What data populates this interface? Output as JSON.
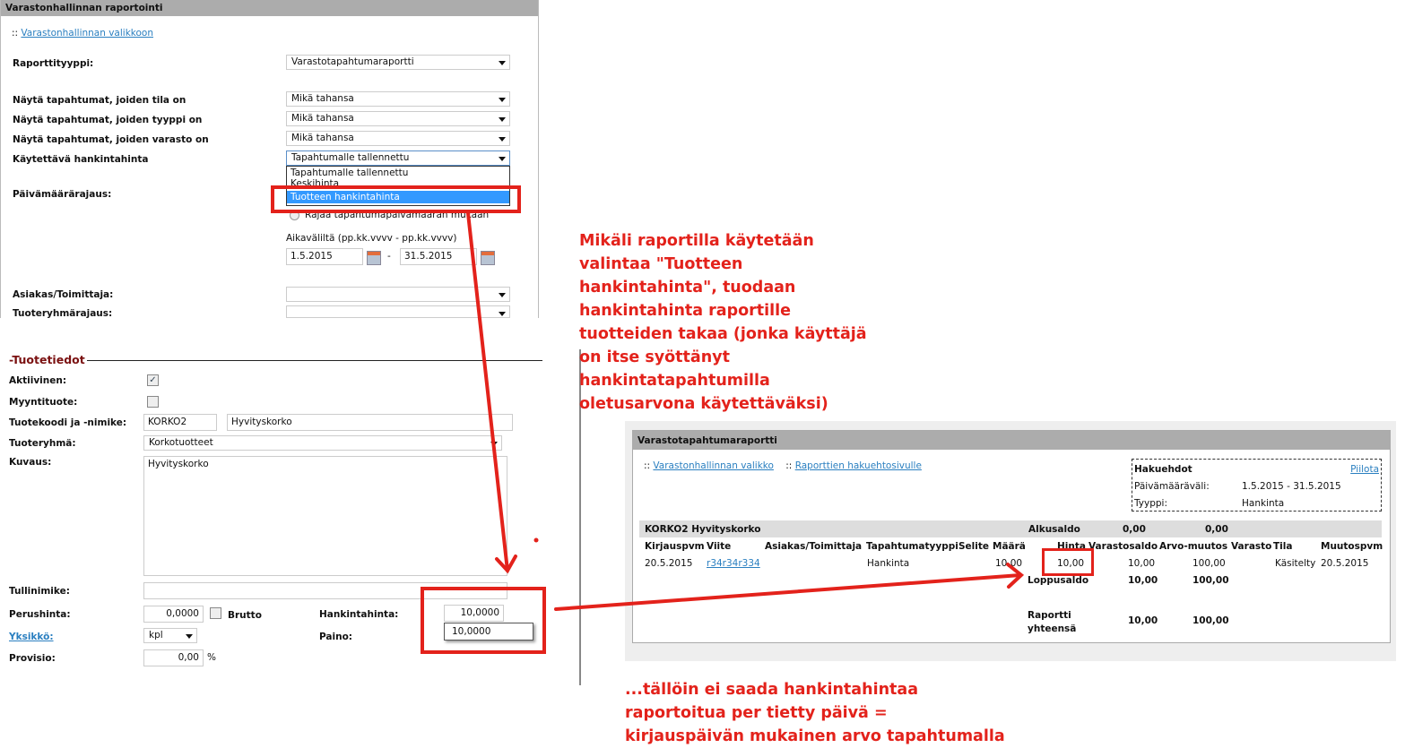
{
  "report_form": {
    "title": "Varastonhallinnan raportointi",
    "back_link": "Varastonhallinnan valikkoon",
    "fields": [
      {
        "label": "Raporttityyppi:",
        "value": "Varastotapahtumaraportti"
      },
      {
        "label": "Näytä tapahtumat, joiden tila on",
        "value": "Mikä tahansa"
      },
      {
        "label": "Näytä tapahtumat, joiden tyyppi on",
        "value": "Mikä tahansa"
      },
      {
        "label": "Näytä tapahtumat, joiden varasto on",
        "value": "Mikä tahansa"
      },
      {
        "label": "Käytettävä hankintahinta",
        "value": "Tapahtumalle tallennettu"
      }
    ],
    "dropdown_options": [
      "Tapahtumalle tallennettu",
      "Keskihinta",
      "Tuotteen hankintahinta"
    ],
    "date_label": "Päivämäärärajaus:",
    "date_radio": "Rajaa tapahtumapäivämäärän mukaan",
    "range_label": "Aikaväliltä (pp.kk.vvvv - pp.kk.vvvv)",
    "date_from": "1.5.2015",
    "date_sep": "-",
    "date_to": "31.5.2015",
    "customer_label": "Asiakas/Toimittaja:",
    "group_label": "Tuoteryhmärajaus:"
  },
  "product": {
    "legend": "Tuotetiedot",
    "active_label": "Aktiivinen:",
    "sales_label": "Myyntituote:",
    "code_label": "Tuotekoodi ja -nimike:",
    "code": "KORKO2",
    "name": "Hyvityskorko",
    "group_label": "Tuoteryhmä:",
    "group": "Korkotuotteet",
    "desc_label": "Kuvaus:",
    "desc": "Hyvityskorko",
    "customs_label": "Tullinimike:",
    "base_price_label": "Perushinta:",
    "base_price": "0,0000",
    "gross_label": "Brutto",
    "purchase_label": "Hankintahinta:",
    "purchase_price": "10,0000",
    "autocomplete": "10,0000",
    "unit_label": "Yksikkö:",
    "unit": "kpl",
    "weight_label": "Paino:",
    "commission_label": "Provisio:",
    "commission": "0,00",
    "pct": "%"
  },
  "report": {
    "title": "Varastotapahtumaraportti",
    "link1": "Varastonhallinnan valikko",
    "link2": "Raporttien hakuehtosivulle",
    "criteria": {
      "title": "Hakuehdot",
      "hide": "Piilota",
      "date_label": "Päivämääräväli:",
      "date_value": "1.5.2015 - 31.5.2015",
      "type_label": "Tyyppi:",
      "type_value": "Hankinta"
    },
    "product": "KORKO2 Hyvityskorko",
    "start_label": "Alkusaldo",
    "start_qty": "0,00",
    "start_value": "0,00",
    "columns": [
      "Kirjauspvm",
      "Viite",
      "Asiakas/Toimittaja",
      "Tapahtumatyyppi",
      "Selite",
      "Määrä",
      "Hinta",
      "Varastosaldo",
      "Arvo-muutos",
      "Varasto",
      "Tila",
      "Muutospvm"
    ],
    "row": {
      "date": "20.5.2015",
      "ref": "r34r34r334",
      "type": "Hankinta",
      "qty": "10,00",
      "price": "10,00",
      "balance": "10,00",
      "change": "100,00",
      "status": "Käsitelty",
      "modified": "20.5.2015"
    },
    "end_label": "Loppusaldo",
    "end_qty": "10,00",
    "end_value": "100,00",
    "total_label": "Raportti yhteensä",
    "total_qty": "10,00",
    "total_value": "100,00"
  },
  "annotations": {
    "note1": "Mikäli raportilla käytetään valintaa \"Tuotteen hankintahinta\", tuodaan hankintahinta raportille tuotteiden takaa (jonka käyttäjä on itse syöttänyt hankintatapahtumilla oletusarvona käytettäväksi)",
    "note2": "...tällöin ei saada hankintahintaa raportoitua per tietty päivä = kirjauspäivän mukainen arvo tapahtumalla"
  }
}
